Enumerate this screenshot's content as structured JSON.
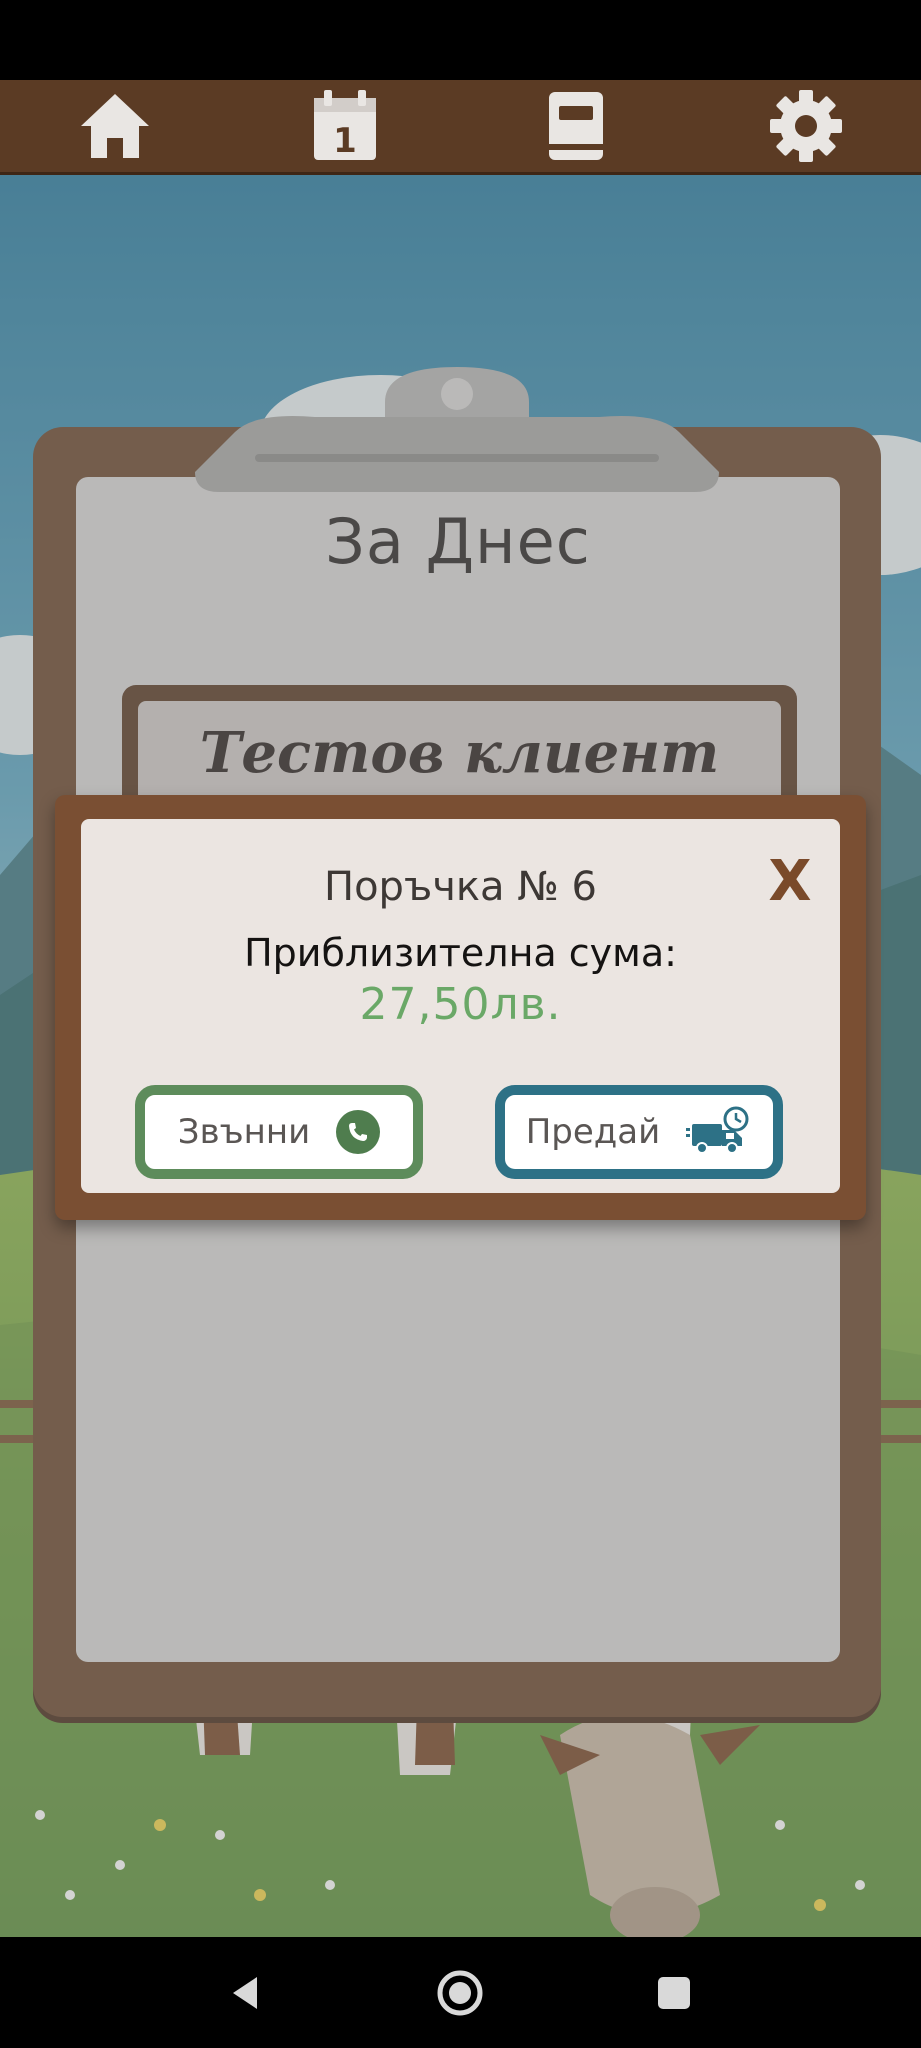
{
  "navigation": {
    "items": [
      {
        "name": "home",
        "icon": "home-icon"
      },
      {
        "name": "calendar",
        "icon": "calendar-icon",
        "badge": "1"
      },
      {
        "name": "book",
        "icon": "book-icon"
      },
      {
        "name": "settings",
        "icon": "gear-icon"
      }
    ]
  },
  "clipboard": {
    "title": "За Днес",
    "client_name": "Тестов клиент"
  },
  "modal": {
    "order_title": "Поръчка № 6",
    "close_label": "X",
    "approx_sum_label": "Приблизителна сума:",
    "approx_sum_value": "27,50лв.",
    "call_button_label": "Звънни",
    "deliver_button_label": "Предай"
  },
  "colors": {
    "nav_bar": "#5b3b24",
    "clipboard_frame": "#6e4a30",
    "sum_green": "#6aa867",
    "call_border": "#5d8c5b",
    "deliver_border": "#2d7186"
  },
  "system_nav": {
    "buttons": [
      "back-icon",
      "home-circle-icon",
      "recents-icon"
    ]
  }
}
